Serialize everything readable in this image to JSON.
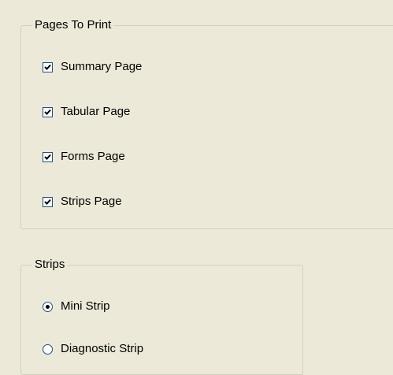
{
  "pages_group": {
    "title": "Pages To Print",
    "options": [
      {
        "label": "Summary Page",
        "checked": true
      },
      {
        "label": "Tabular Page",
        "checked": true
      },
      {
        "label": "Forms Page",
        "checked": true
      },
      {
        "label": "Strips Page",
        "checked": true
      }
    ]
  },
  "strips_group": {
    "title": "Strips",
    "options": [
      {
        "label": "Mini Strip",
        "selected": true
      },
      {
        "label": "Diagnostic Strip",
        "selected": false
      }
    ]
  }
}
